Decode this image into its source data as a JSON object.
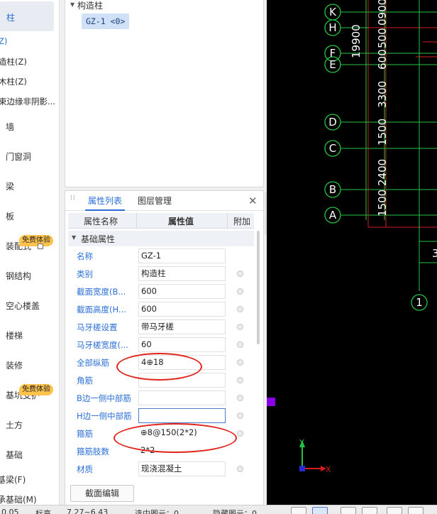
{
  "left_nav": {
    "selected": "柱",
    "sub_items": [
      {
        "label": "Z)",
        "active": true
      },
      {
        "label": "造柱(Z)",
        "active": false
      },
      {
        "label": "木柱(Z)",
        "active": false
      },
      {
        "label": "束边缘非阴影...",
        "active": false
      }
    ],
    "items": [
      "墙",
      "门窗洞",
      "梁",
      "板",
      "装配式",
      "钢结构",
      "空心楼盖",
      "楼梯",
      "装修",
      "基坑支护",
      "土方",
      "基础"
    ],
    "badge": "免费体验",
    "bottom_items": [
      "基梁(F)",
      "承基础(M)"
    ]
  },
  "tree": {
    "root": "构造柱",
    "child": "GZ-1 <0>"
  },
  "property_panel": {
    "tabs": [
      "属性列表",
      "图层管理"
    ],
    "close_icon": "close-icon",
    "columns": [
      "属性名称",
      "属性值",
      "附加"
    ],
    "group": "基础属性",
    "rows": [
      {
        "name": "名称",
        "value": "GZ-1"
      },
      {
        "name": "类别",
        "value": "构造柱"
      },
      {
        "name": "截面宽度(B...",
        "value": "600"
      },
      {
        "name": "截面高度(H...",
        "value": "600"
      },
      {
        "name": "马牙槎设置",
        "value": "带马牙槎"
      },
      {
        "name": "马牙槎宽度(...",
        "value": "60"
      },
      {
        "name": "全部纵筋",
        "value": "4⊕18"
      },
      {
        "name": "角筋",
        "value": ""
      },
      {
        "name": "B边一侧中部筋",
        "value": ""
      },
      {
        "name": "H边一侧中部筋",
        "value": ""
      },
      {
        "name": "箍筋",
        "value": "⊕8@150(2*2)"
      },
      {
        "name": "箍筋肢数",
        "value": "2*2"
      },
      {
        "name": "材质",
        "value": "现浇混凝土"
      }
    ],
    "section_edit_button": "截面编辑"
  },
  "cad": {
    "axis_labels": [
      "K",
      "H",
      "F",
      "E",
      "D",
      "C",
      "B",
      "A"
    ],
    "grid_number": "1",
    "dimensions": [
      "19900",
      "3300",
      "1500",
      "2400",
      "1500",
      "0900",
      "500",
      "600"
    ],
    "partial_text": "3",
    "ucs": {
      "x": "X",
      "y": "Y"
    }
  },
  "status_bar": {
    "coord_label": "标高",
    "coord_value": "7.27~6.43",
    "selected_text": "选中图元：0",
    "hidden_text": "隐藏图元：0",
    "left_text": "0.05"
  },
  "colors": {
    "accent": "#2b6fd6",
    "cad_background": "#000000",
    "axis_green": "#23c443",
    "grid_red": "#d21e1e",
    "annotation_red": "#e2231a",
    "badge": "#ffc34d"
  }
}
